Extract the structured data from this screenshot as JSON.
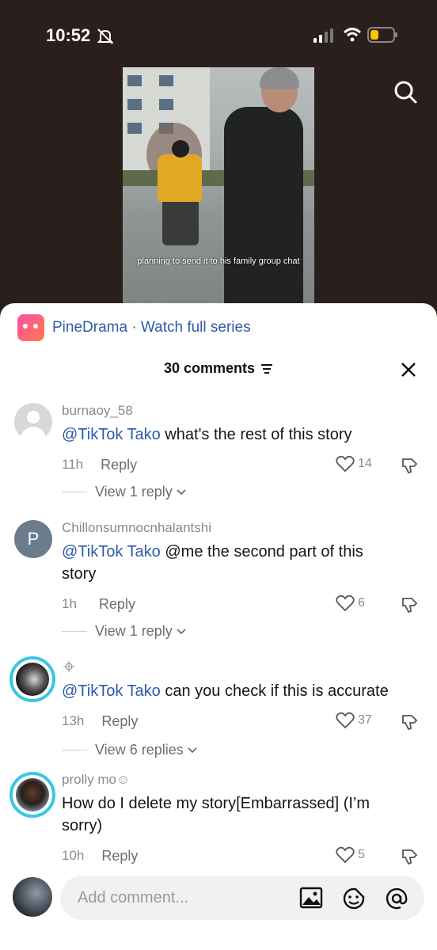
{
  "status": {
    "time": "10:52"
  },
  "video": {
    "caption": "planning to send it to his family group chat"
  },
  "promo": {
    "text": "PineDrama · Watch full series"
  },
  "sheet": {
    "comment_count": "30 comments"
  },
  "comments": [
    {
      "username": "burnaoy_58",
      "mention": "@TikTok Tako",
      "text": " what's the rest of this story",
      "time": "11h",
      "reply": "Reply",
      "likes": "14",
      "view_replies": "View 1 reply"
    },
    {
      "username": "Chillonsumnocnhalantshi",
      "avatar_letter": "P",
      "mention": "@TikTok Tako",
      "text": " @me the second part of this story",
      "time": "1h",
      "reply": "Reply",
      "likes": "6",
      "view_replies": "View 1 reply"
    },
    {
      "username": "",
      "mention": "@TikTok Tako",
      "text": " can you check if this is accurate",
      "time": "13h",
      "reply": "Reply",
      "likes": "37",
      "view_replies": "View 6 replies"
    },
    {
      "username": "prolly mo☺",
      "mention": "",
      "text": "How do I delete my story[Embarrassed] (I’m sorry)",
      "time": "10h",
      "reply": "Reply",
      "likes": "5"
    }
  ],
  "composer": {
    "placeholder": "Add comment..."
  },
  "colors": {
    "link": "#2f5aa8",
    "background": "#2a1f1c"
  },
  "icons": [
    "mute-icon",
    "signal-icon",
    "wifi-icon",
    "battery-icon",
    "search-icon",
    "filter-icon",
    "close-icon",
    "heart-icon",
    "dislike-icon",
    "chevron-down-icon",
    "image-icon",
    "emoji-icon",
    "at-icon"
  ]
}
